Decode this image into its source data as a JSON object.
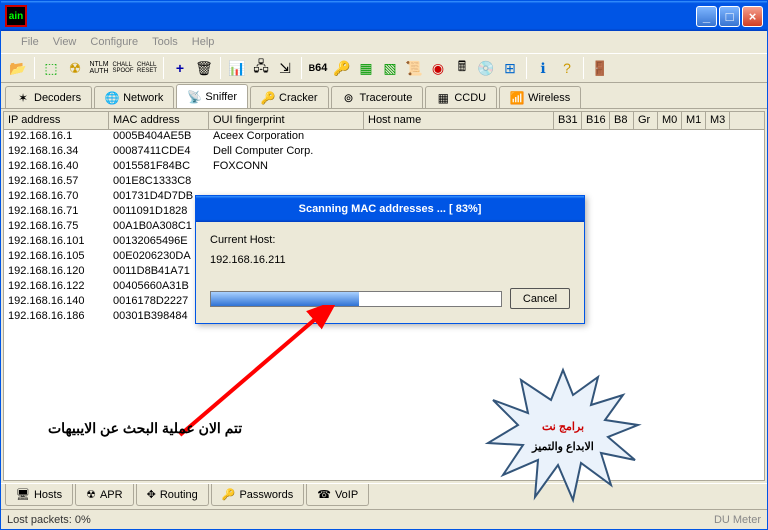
{
  "app_icon_text": "ain",
  "menu": [
    "File",
    "View",
    "Configure",
    "Tools",
    "Help"
  ],
  "tabs_top": [
    {
      "icon": "✶",
      "label": "Decoders"
    },
    {
      "icon": "🌐",
      "label": "Network"
    },
    {
      "icon": "📡",
      "label": "Sniffer",
      "active": true
    },
    {
      "icon": "🔑",
      "label": "Cracker"
    },
    {
      "icon": "⊚",
      "label": "Traceroute"
    },
    {
      "icon": "▦",
      "label": "CCDU"
    },
    {
      "icon": "📶",
      "label": "Wireless"
    }
  ],
  "columns": [
    "IP address",
    "MAC address",
    "OUI fingerprint",
    "Host name",
    "B31",
    "B16",
    "B8",
    "Gr",
    "M0",
    "M1",
    "M3"
  ],
  "rows": [
    {
      "ip": "192.168.16.1",
      "mac": "0005B404AE5B",
      "oui": "Aceex Corporation"
    },
    {
      "ip": "192.168.16.34",
      "mac": "00087411CDE4",
      "oui": "Dell Computer Corp."
    },
    {
      "ip": "192.168.16.40",
      "mac": "0015581F84BC",
      "oui": "FOXCONN"
    },
    {
      "ip": "192.168.16.57",
      "mac": "001E8C1333C8",
      "oui": ""
    },
    {
      "ip": "192.168.16.70",
      "mac": "001731D4D7DB",
      "oui": ""
    },
    {
      "ip": "192.168.16.71",
      "mac": "0011091D1828",
      "oui": ""
    },
    {
      "ip": "192.168.16.75",
      "mac": "00A1B0A308C1",
      "oui": ""
    },
    {
      "ip": "192.168.16.101",
      "mac": "00132065496E",
      "oui": ""
    },
    {
      "ip": "192.168.16.105",
      "mac": "00E0206230DA",
      "oui": ""
    },
    {
      "ip": "192.168.16.120",
      "mac": "0011D8B41A71",
      "oui": ""
    },
    {
      "ip": "192.168.16.122",
      "mac": "00405660A31B",
      "oui": ""
    },
    {
      "ip": "192.168.16.140",
      "mac": "0016178D2227",
      "oui": ""
    },
    {
      "ip": "192.168.16.186",
      "mac": "00301B398484",
      "oui": ""
    }
  ],
  "dialog": {
    "title": "Scanning MAC addresses ... [ 83%]",
    "label": "Current Host:",
    "host": "192.168.16.211",
    "cancel": "Cancel",
    "progress_pct": 51
  },
  "tabs_bottom": [
    {
      "icon": "🖥",
      "label": "Hosts"
    },
    {
      "icon": "☢",
      "label": "APR"
    },
    {
      "icon": "✥",
      "label": "Routing"
    },
    {
      "icon": "🔑",
      "label": "Passwords"
    },
    {
      "icon": "☎",
      "label": "VoIP"
    }
  ],
  "status": {
    "left": "Lost packets:  0%",
    "right": "DU Meter"
  },
  "annotation": "تتم الان عملية البحث عن الايبيهات",
  "star": {
    "line1": "برامج نت",
    "line2": "الابداع والتميز"
  }
}
